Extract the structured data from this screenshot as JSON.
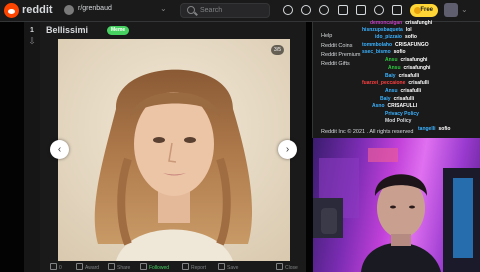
{
  "header": {
    "logo_text": "reddit",
    "subreddit": "r/grenbaud",
    "search_placeholder": "Search",
    "free_label": "Free"
  },
  "post": {
    "vote_count": "1",
    "title": "Bellissimi",
    "flair": "Meme",
    "image_counter": "3/5",
    "actions": [
      "0",
      "Award",
      "Share",
      "Followed",
      "Report",
      "Save",
      "Close"
    ]
  },
  "sidebar": {
    "links": [
      "Help",
      "Reddit Coins",
      "Reddit Premium",
      "Reddit Gifts"
    ],
    "copyright": "Reddit Inc © 2021 . All rights reserved"
  },
  "chat": [
    {
      "user": "demoncaigan",
      "msg": "crisafunghi",
      "color": "#c040c0"
    },
    {
      "user": "hisnzupsbaqueta",
      "msg": "lol",
      "color": "#3bb3ff"
    },
    {
      "user": "ido_pizzaio",
      "msg": "sofio",
      "color": "#3bb3ff"
    },
    {
      "user": "tommbolaho",
      "msg": "CRISAFUNGO",
      "color": "#3bb3ff"
    },
    {
      "user": "ssec_bismo",
      "msg": "sofio",
      "color": "#3bb3ff"
    },
    {
      "user": "Ansu",
      "msg": "crisafunghi",
      "color": "#2ecc40"
    },
    {
      "user": "Ansu",
      "msg": "crisafunghi",
      "color": "#2ecc40"
    },
    {
      "user": "Baiy",
      "msg": "crisafulli",
      "color": "#3bb3ff"
    },
    {
      "user": "fuarzei_peccaione",
      "msg": "crisafulli",
      "color": "#ff4040"
    },
    {
      "user": "Ansu",
      "msg": "crisafulli",
      "color": "#3bb3ff"
    },
    {
      "user": "Baiy",
      "msg": "crisafulli",
      "color": "#3bb3ff"
    },
    {
      "user": "Asno",
      "msg": "CRISAFULLI",
      "color": "#3bb3ff"
    },
    {
      "user": "Privacy Policy",
      "msg": "",
      "color": "#3bb3ff"
    },
    {
      "user": "Mod Policy",
      "msg": "",
      "color": "#d7dadc"
    },
    {
      "user": "tangelli",
      "msg": "sofio",
      "color": "#3bb3ff"
    }
  ]
}
